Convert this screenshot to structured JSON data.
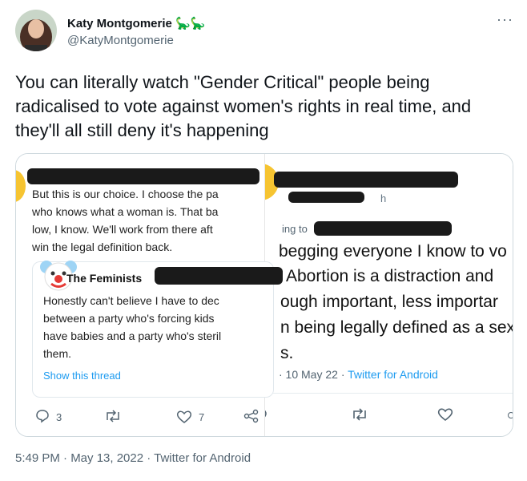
{
  "author": {
    "name": "Katy Montgomerie",
    "name_emoji": "🦕🦕",
    "handle": "@KatyMontgomerie"
  },
  "menu_icon": "more-icon",
  "tweet": {
    "text": "You can literally watch \"Gender Critical\" people being radicalised to vote against women's rights in real time, and they'll all still deny it's happening"
  },
  "screenshot_left": {
    "reply_lines": [
      "But this is our choice. I choose the pa",
      "who knows what a woman is. That ba",
      "low, I know. We'll work from there aft",
      "win the legal definition back."
    ],
    "quoted_name": "The Feminists",
    "quoted_lines": [
      "Honestly can't believe I have to dec",
      "between a party who's forcing kids",
      "have babies and a party who's steril",
      "them."
    ],
    "show_thread": "Show this thread",
    "reply_count": "3",
    "like_count": "7"
  },
  "screenshot_right": {
    "handle_frag": "h",
    "reply_to_frag": "ing to",
    "lines": [
      "begging everyone I know to vo",
      "Abortion is a distraction and",
      "ough important, less importar",
      "n being legally defined as a sex",
      "s."
    ],
    "meta_date": "· 10 May 22 · ",
    "meta_source": "Twitter for Android"
  },
  "footer": {
    "text": "5:49 PM · May 13, 2022 · Twitter for Android"
  }
}
